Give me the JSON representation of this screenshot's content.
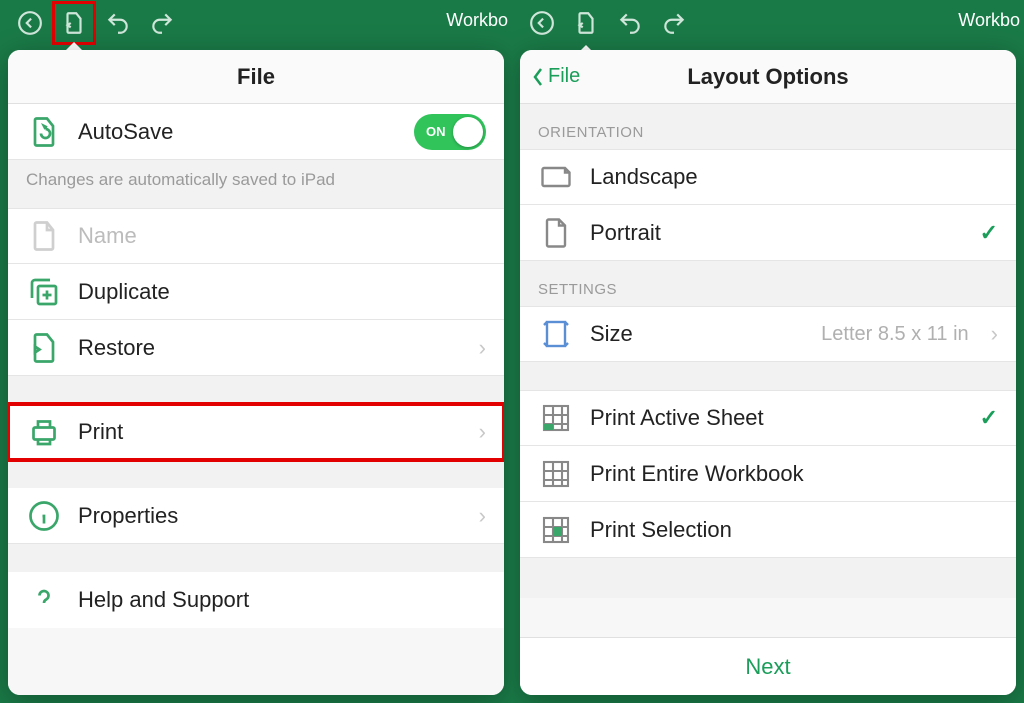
{
  "app": {
    "workbook_label": "Workbo"
  },
  "left": {
    "popover_title": "File",
    "autosave": {
      "label": "AutoSave",
      "toggle_text": "ON"
    },
    "subtext": "Changes are automatically saved to iPad",
    "items": {
      "name": "Name",
      "duplicate": "Duplicate",
      "restore": "Restore",
      "print": "Print",
      "properties": "Properties",
      "help": "Help and Support"
    }
  },
  "right": {
    "back_label": "File",
    "popover_title": "Layout Options",
    "sections": {
      "orientation": "ORIENTATION",
      "settings": "SETTINGS"
    },
    "items": {
      "landscape": "Landscape",
      "portrait": "Portrait",
      "size": {
        "label": "Size",
        "value": "Letter 8.5 x 11 in"
      },
      "print_active": "Print Active Sheet",
      "print_workbook": "Print Entire Workbook",
      "print_selection": "Print Selection"
    },
    "footer": "Next"
  }
}
